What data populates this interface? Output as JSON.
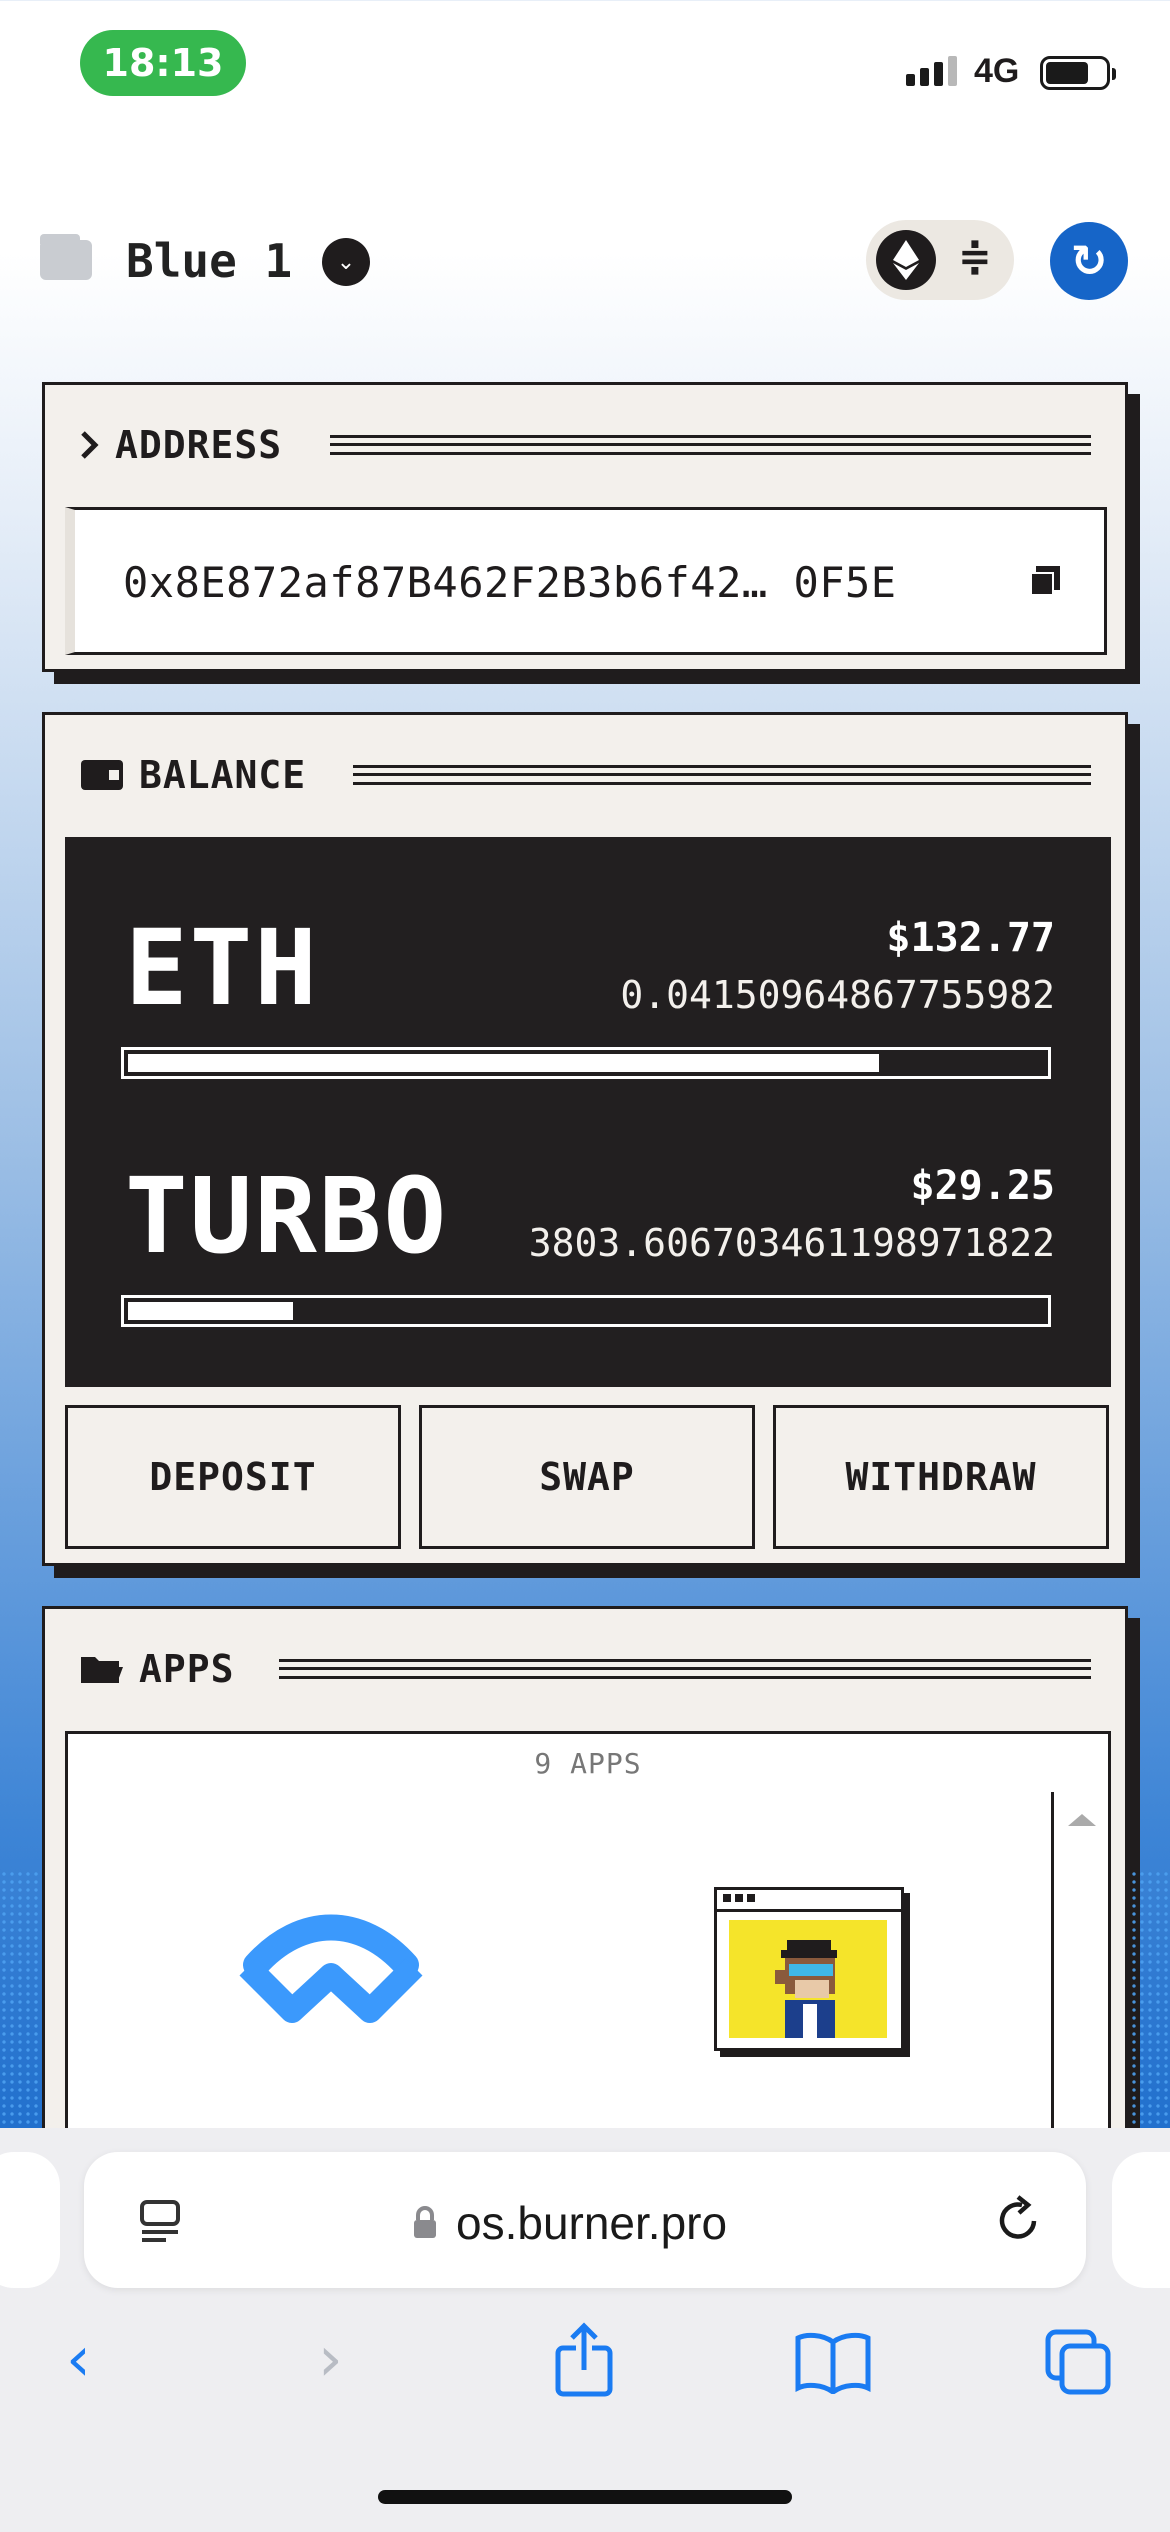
{
  "status_bar": {
    "time": "18:13",
    "network": "4G"
  },
  "header": {
    "wallet_name": "Blue 1",
    "chevron": "⌄",
    "swap_glyph": "≑",
    "refresh_glyph": "↻"
  },
  "address_panel": {
    "title": "ADDRESS",
    "address": "0x8E872af87B462F2B3b6f42… 0F5E"
  },
  "balance_panel": {
    "title": "BALANCE",
    "assets": [
      {
        "symbol": "ETH",
        "usd": "$132.77",
        "amount": "0.04150964867755982",
        "share": 0.82
      },
      {
        "symbol": "TURBO",
        "usd": "$29.25",
        "amount": "3803.606703461198971822",
        "share": 0.18
      }
    ],
    "actions": {
      "deposit": "DEPOSIT",
      "swap": "SWAP",
      "withdraw": "WITHDRAW"
    }
  },
  "apps_panel": {
    "title": "APPS",
    "count_label": "9 APPS",
    "apps": [
      {
        "icon": "walletconnect-icon"
      },
      {
        "icon": "bored-ape-icon"
      }
    ]
  },
  "browser": {
    "url": "os.burner.pro",
    "nav": {
      "back": "‹",
      "forward": "›"
    }
  },
  "colors": {
    "accent": "#1665c8",
    "dark": "#221f20",
    "panel_bg": "#f3f0ec",
    "status_green": "#36b84f",
    "ios_blue": "#1a7bf2"
  }
}
